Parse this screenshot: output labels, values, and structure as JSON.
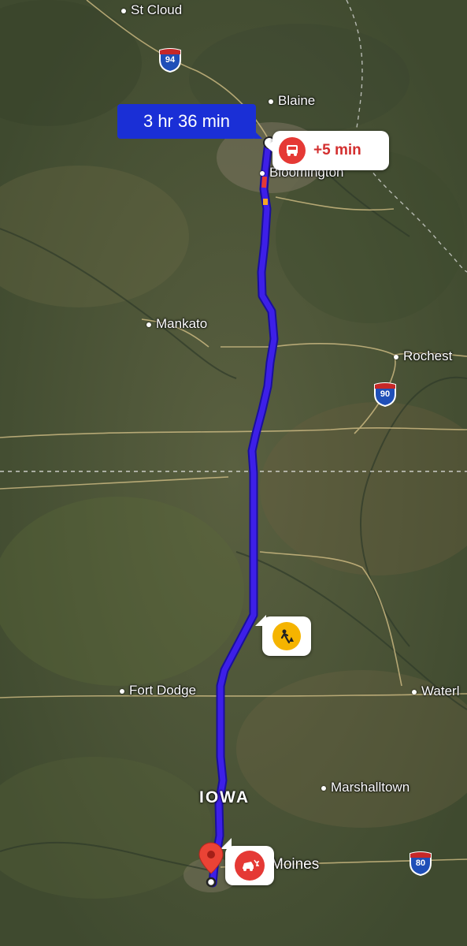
{
  "colors": {
    "route": "#3d1fe8",
    "route_outline": "#1a0f9c",
    "duration_bg": "#1a2fd6",
    "traffic_red": "#e53935",
    "construction_yellow": "#f5b400",
    "pin_red": "#ea4335"
  },
  "route": {
    "duration": "3 hr 36 min",
    "delay": "+5 min"
  },
  "cities": {
    "st_cloud": "St Cloud",
    "blaine": "Blaine",
    "bloomington": "Bloomington",
    "mankato": "Mankato",
    "rochester": "Rochest",
    "fort_dodge": "Fort Dodge",
    "waterloo": "Waterl",
    "marshalltown": "Marshalltown",
    "des_moines": "Moines"
  },
  "state_label": "IOWA",
  "shields": {
    "i94": "94",
    "i90": "90",
    "i80": "80"
  },
  "icons": {
    "delay": "car-traffic-icon",
    "construction": "construction-worker-icon",
    "crash": "car-crash-icon",
    "destination": "map-pin-icon"
  }
}
